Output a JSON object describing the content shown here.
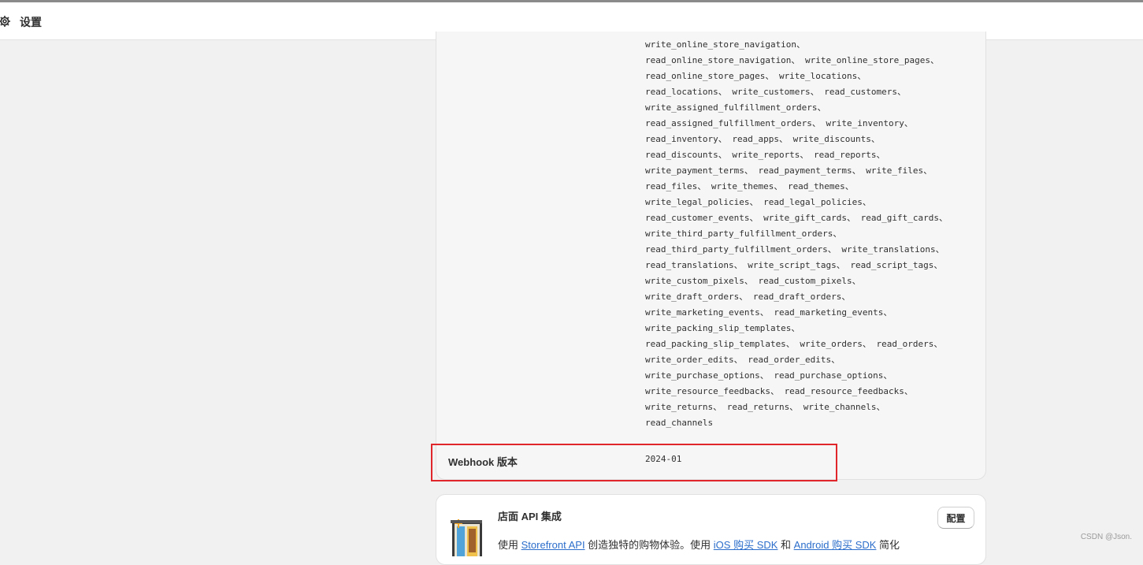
{
  "header": {
    "title": "设置",
    "icon": "gear-icon"
  },
  "scopes": [
    "write_online_store_navigation、",
    "read_online_store_navigation、 write_online_store_pages、",
    "read_online_store_pages、 write_locations、",
    "read_locations、 write_customers、 read_customers、",
    "write_assigned_fulfillment_orders、",
    "read_assigned_fulfillment_orders、 write_inventory、",
    "read_inventory、 read_apps、 write_discounts、",
    "read_discounts、 write_reports、 read_reports、",
    "write_payment_terms、 read_payment_terms、 write_files、",
    "read_files、 write_themes、 read_themes、",
    "write_legal_policies、 read_legal_policies、",
    "read_customer_events、 write_gift_cards、 read_gift_cards、",
    "write_third_party_fulfillment_orders、",
    "read_third_party_fulfillment_orders、 write_translations、",
    "read_translations、 write_script_tags、 read_script_tags、",
    "write_custom_pixels、 read_custom_pixels、",
    "write_draft_orders、 read_draft_orders、",
    "write_marketing_events、 read_marketing_events、",
    "write_packing_slip_templates、",
    "read_packing_slip_templates、 write_orders、 read_orders、",
    "write_order_edits、 read_order_edits、",
    "write_purchase_options、 read_purchase_options、",
    "write_resource_feedbacks、 read_resource_feedbacks、",
    "write_returns、 read_returns、 write_channels、",
    "read_channels"
  ],
  "webhook": {
    "label": "Webhook 版本",
    "value": "2024-01"
  },
  "storefront": {
    "title": "店面 API 集成",
    "button_label": "配置",
    "desc_1": "使用 ",
    "link_storefront": "Storefront API",
    "desc_2": " 创造独特的购物体验。使用 ",
    "link_ios": "iOS 购买 SDK",
    "desc_3": " 和 ",
    "link_android": "Android 购买 SDK",
    "desc_4": " 简化",
    "icon": "storefront-icon"
  },
  "watermark": "CSDN @Json."
}
